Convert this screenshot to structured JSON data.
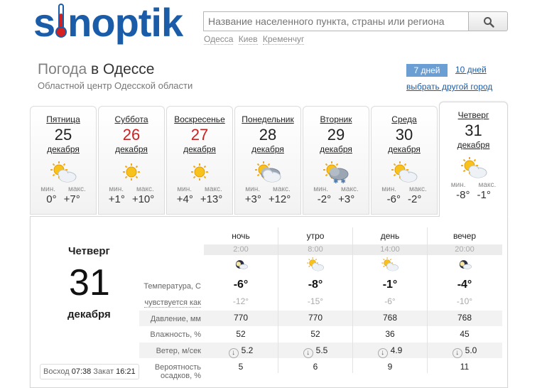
{
  "logo": {
    "prefix": "s",
    "suffix": "noptik"
  },
  "search": {
    "placeholder": "Название населенного пункта, страны или региона",
    "quick_links": [
      "Одесса",
      "Киев",
      "Кременчуг"
    ]
  },
  "title": {
    "light": "Погода",
    "main": "в Одессе"
  },
  "subtitle": "Областной центр Одесской области",
  "controls": {
    "days7": "7 дней",
    "days10": "10 дней",
    "other_city": "выбрать другой город"
  },
  "days": [
    {
      "dow": "Пятница",
      "num": "25",
      "month": "декабря",
      "weekend": false,
      "min_label": "мин.",
      "max_label": "макс.",
      "min": "0°",
      "max": "+7°",
      "icon": "partly-cloudy-icon"
    },
    {
      "dow": "Суббота",
      "num": "26",
      "month": "декабря",
      "weekend": true,
      "min_label": "мин.",
      "max_label": "макс.",
      "min": "+1°",
      "max": "+10°",
      "icon": "sun-icon"
    },
    {
      "dow": "Воскресенье",
      "num": "27",
      "month": "декабря",
      "weekend": true,
      "min_label": "мин.",
      "max_label": "макс.",
      "min": "+4°",
      "max": "+13°",
      "icon": "sun-icon"
    },
    {
      "dow": "Понедельник",
      "num": "28",
      "month": "декабря",
      "weekend": false,
      "min_label": "мин.",
      "max_label": "макс.",
      "min": "+3°",
      "max": "+12°",
      "icon": "cloudy-icon"
    },
    {
      "dow": "Вторник",
      "num": "29",
      "month": "декабря",
      "weekend": false,
      "min_label": "мин.",
      "max_label": "макс.",
      "min": "-2°",
      "max": "+3°",
      "icon": "snow-icon"
    },
    {
      "dow": "Среда",
      "num": "30",
      "month": "декабря",
      "weekend": false,
      "min_label": "мин.",
      "max_label": "макс.",
      "min": "-6°",
      "max": "-2°",
      "icon": "partly-cloudy-icon"
    },
    {
      "dow": "Четверг",
      "num": "31",
      "month": "декабря",
      "weekend": false,
      "min_label": "мин.",
      "max_label": "макс.",
      "min": "-8°",
      "max": "-1°",
      "icon": "partly-cloudy-icon"
    }
  ],
  "detail": {
    "dow": "Четверг",
    "num": "31",
    "month": "декабря",
    "sunrise_label": "Восход",
    "sunrise": "07:38",
    "sunset_label": "Закат",
    "sunset": "16:21",
    "labels": {
      "temp": "Температура, С",
      "feels": "чувствуется как",
      "pressure": "Давление, мм",
      "humidity": "Влажность, %",
      "wind": "Ветер, м/сек",
      "precip1": "Вероятность",
      "precip2": "осадков, %"
    },
    "periods": [
      {
        "name": "ночь",
        "time": "2:00",
        "icon": "night-cloudy-icon",
        "temp": "-6°",
        "feels": "-12°",
        "pressure": "770",
        "humidity": "52",
        "wind": "5.2",
        "precip": "5"
      },
      {
        "name": "утро",
        "time": "8:00",
        "icon": "partly-cloudy-icon",
        "temp": "-8°",
        "feels": "-15°",
        "pressure": "770",
        "humidity": "52",
        "wind": "5.5",
        "precip": "6"
      },
      {
        "name": "день",
        "time": "14:00",
        "icon": "partly-cloudy-icon",
        "temp": "-1°",
        "feels": "-6°",
        "pressure": "768",
        "humidity": "36",
        "wind": "4.9",
        "precip": "9"
      },
      {
        "name": "вечер",
        "time": "20:00",
        "icon": "night-cloudy-icon",
        "temp": "-4°",
        "feels": "-10°",
        "pressure": "768",
        "humidity": "45",
        "wind": "5.0",
        "precip": "11"
      }
    ]
  },
  "colors": {
    "brand": "#1a5ca8",
    "weekend": "#c82222",
    "active_tab": "#6b9fd4"
  }
}
